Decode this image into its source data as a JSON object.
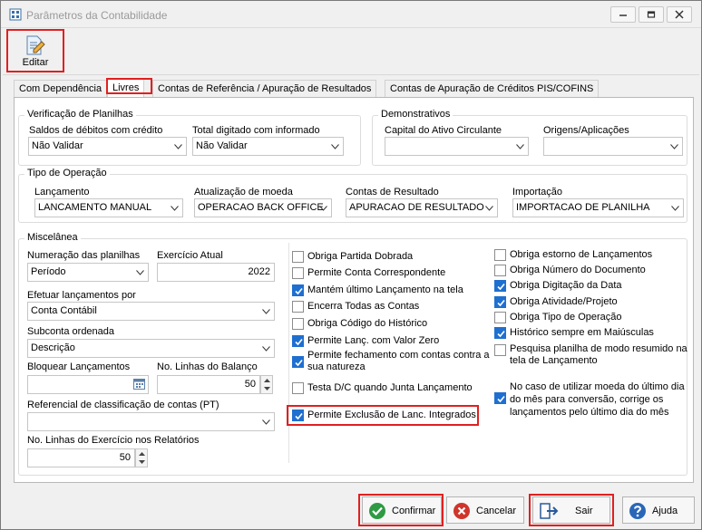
{
  "window": {
    "title": "Parâmetros da Contabilidade"
  },
  "toolbar": {
    "edit_label": "Editar"
  },
  "tabs": [
    {
      "label": "Com Dependência"
    },
    {
      "label": "Livres"
    },
    {
      "label": "Contas de Referência / Apuração de Resultados"
    },
    {
      "label": "Contas de Apuração de Créditos PIS/COFINS"
    }
  ],
  "verificacao": {
    "title": "Verificação de Planilhas",
    "saldos_label": "Saldos de débitos com crédito",
    "saldos_value": "Não Validar",
    "total_label": "Total digitado com informado",
    "total_value": "Não Validar"
  },
  "demonstrativos": {
    "title": "Demonstrativos",
    "capital_label": "Capital do Ativo Circulante",
    "capital_value": "",
    "origens_label": "Origens/Aplicações",
    "origens_value": ""
  },
  "tipo_operacao": {
    "title": "Tipo de Operação",
    "lancamento_label": "Lançamento",
    "lancamento_value": "LANCAMENTO MANUAL",
    "moeda_label": "Atualização de moeda",
    "moeda_value": "OPERACAO BACK OFFICE",
    "resultado_label": "Contas de Resultado",
    "resultado_value": "APURACAO DE RESULTADO",
    "importacao_label": "Importação",
    "importacao_value": "IMPORTACAO DE PLANILHA"
  },
  "miscelanea": {
    "title": "Miscelânea",
    "numeracao_label": "Numeração das planilhas",
    "numeracao_value": "Período",
    "exercicio_label": "Exercício Atual",
    "exercicio_value": "2022",
    "efetuar_label": "Efetuar lançamentos por",
    "efetuar_value": "Conta Contábil",
    "subconta_label": "Subconta ordenada",
    "subconta_value": "Descrição",
    "bloquear_label": "Bloquear Lançamentos",
    "bloquear_value": "",
    "linhas_balanco_label": "No. Linhas do Balanço",
    "linhas_balanco_value": "50",
    "referencial_label": "Referencial de classificação de contas (PT)",
    "referencial_value": "",
    "linhas_exercicio_label": "No. Linhas do Exercício nos Relatórios",
    "linhas_exercicio_value": "50"
  },
  "checks_left": [
    {
      "label": "Obriga Partida Dobrada",
      "checked": false
    },
    {
      "label": "Permite Conta Correspondente",
      "checked": false
    },
    {
      "label": "Mantém último Lançamento na tela",
      "checked": true
    },
    {
      "label": "Encerra Todas as Contas",
      "checked": false
    },
    {
      "label": "Obriga Código do Histórico",
      "checked": false
    },
    {
      "label": "Permite Lanç. com Valor Zero",
      "checked": true
    },
    {
      "label": "Permite fechamento com contas contra a",
      "label2": "sua natureza",
      "checked": true
    },
    {
      "label": "Testa D/C quando Junta Lançamento",
      "checked": false
    },
    {
      "label": "Permite Exclusão de Lanc. Integrados",
      "checked": true
    }
  ],
  "checks_right": [
    {
      "label": "Obriga estorno de Lançamentos",
      "checked": false
    },
    {
      "label": "Obriga Número do Documento",
      "checked": false
    },
    {
      "label": "Obriga Digitação da Data",
      "checked": true
    },
    {
      "label": "Obriga Atividade/Projeto",
      "checked": true
    },
    {
      "label": "Obriga Tipo de Operação",
      "checked": false
    },
    {
      "label": "Histórico sempre em Maiúsculas",
      "checked": true
    },
    {
      "label": "Pesquisa planilha de modo resumido na",
      "label2": "tela de Lançamento",
      "checked": false
    },
    {
      "label": "No caso de utilizar moeda do último dia",
      "label2": "do mês para conversão, corrige os",
      "label3": "lançamentos pelo último dia do mês",
      "checked": true
    }
  ],
  "buttons": {
    "confirm": "Confirmar",
    "cancel": "Cancelar",
    "exit": "Sair",
    "help": "Ajuda"
  },
  "colors": {
    "highlight": "#e02020",
    "check": "#1f6fd0"
  }
}
